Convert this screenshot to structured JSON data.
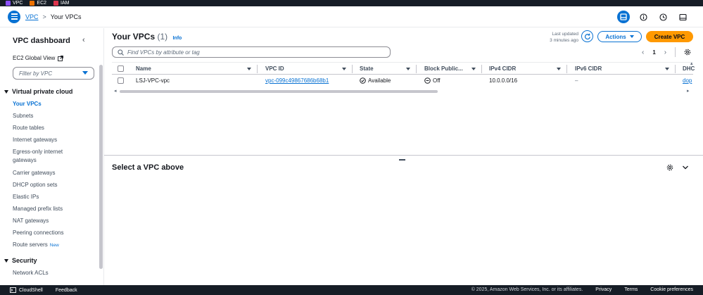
{
  "favorites": [
    {
      "label": "VPC"
    },
    {
      "label": "EC2"
    },
    {
      "label": "IAM"
    }
  ],
  "breadcrumb": {
    "parent": "VPC",
    "current": "Your VPCs"
  },
  "sidebar": {
    "title": "VPC dashboard",
    "global_view": "EC2 Global View",
    "filter_placeholder": "Filter by VPC",
    "section_vpc": "Virtual private cloud",
    "items": [
      {
        "label": "Your VPCs"
      },
      {
        "label": "Subnets"
      },
      {
        "label": "Route tables"
      },
      {
        "label": "Internet gateways"
      },
      {
        "label": "Egress-only internet gateways"
      },
      {
        "label": "Carrier gateways"
      },
      {
        "label": "DHCP option sets"
      },
      {
        "label": "Elastic IPs"
      },
      {
        "label": "Managed prefix lists"
      },
      {
        "label": "NAT gateways"
      },
      {
        "label": "Peering connections"
      },
      {
        "label": "Route servers",
        "badge": "New"
      }
    ],
    "section_security": "Security",
    "security_items": [
      {
        "label": "Network ACLs"
      }
    ]
  },
  "main": {
    "title": "Your VPCs",
    "count": "(1)",
    "info": "Info",
    "last_updated_label": "Last updated",
    "last_updated_value": "3 minutes ago",
    "actions_label": "Actions",
    "create_label": "Create VPC",
    "search_placeholder": "Find VPCs by attribute or tag",
    "page": "1",
    "columns": [
      "Name",
      "VPC ID",
      "State",
      "Block Public...",
      "IPv4 CIDR",
      "IPv6 CIDR",
      "DHC"
    ],
    "rows": [
      {
        "name": "LSJ-VPC-vpc",
        "vpc_id": "vpc-099c49867686b68b1",
        "state": "Available",
        "block": "Off",
        "ipv4": "10.0.0.0/16",
        "ipv6": "–",
        "dhcp": "dop"
      }
    ]
  },
  "detail": {
    "title": "Select a VPC above"
  },
  "footer": {
    "cloudshell": "CloudShell",
    "feedback": "Feedback",
    "copyright": "© 2025, Amazon Web Services, Inc. or its affiliates.",
    "privacy": "Privacy",
    "terms": "Terms",
    "cookies": "Cookie preferences"
  },
  "colors": {
    "accent": "#0972d3",
    "primary_button": "#ff9900",
    "nav_dark": "#161d26"
  }
}
